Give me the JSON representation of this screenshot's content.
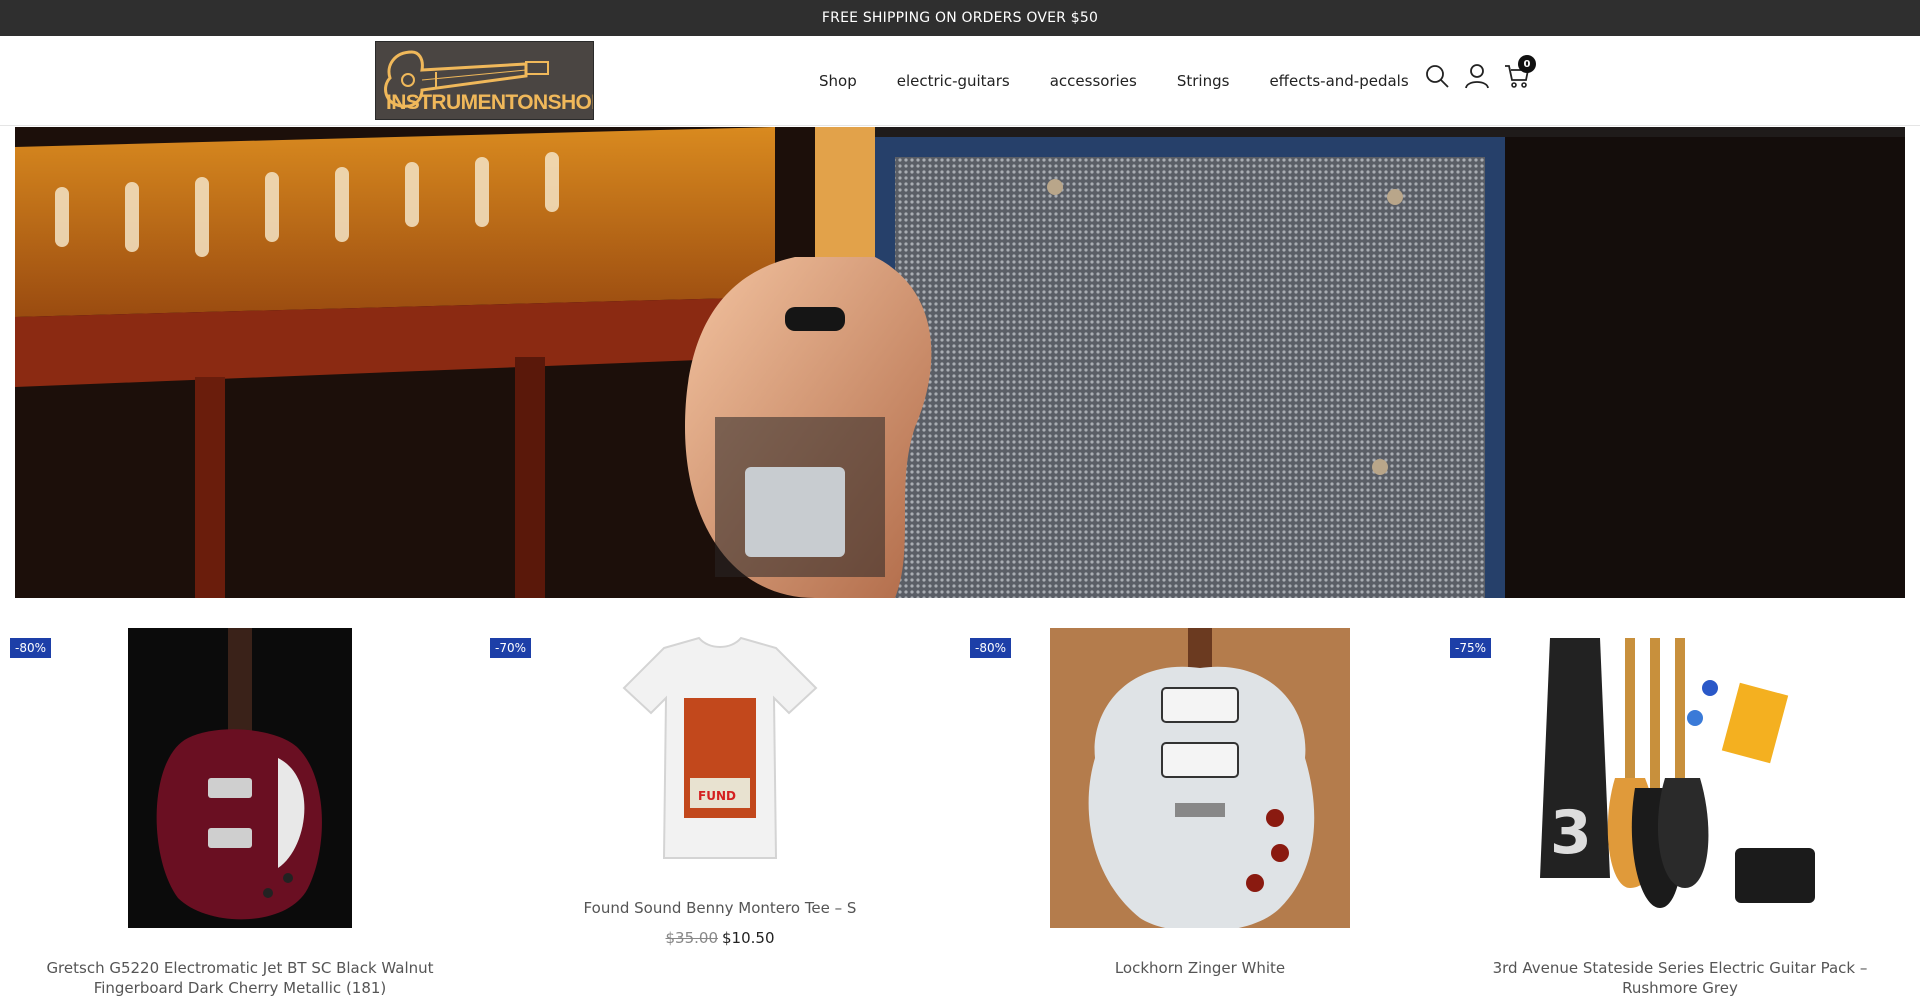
{
  "announcement": "FREE SHIPPING ON ORDERS OVER $50",
  "logo": {
    "text": "INSTRUMENTONSHOP"
  },
  "nav": [
    "Shop",
    "electric-guitars",
    "accessories",
    "Strings",
    "effects-and-pedals"
  ],
  "icons": {
    "search": "search-icon",
    "account": "user-icon",
    "cart": "cart-icon"
  },
  "cart": {
    "count": "0"
  },
  "colors": {
    "topbar": "#2f2f2f",
    "badge": "#1d3fa8",
    "logo_bg": "#4a4542",
    "logo_text": "#f0b85a"
  },
  "products": [
    {
      "discount": "-80%",
      "title": "Gretsch G5220 Electromatic Jet BT SC Black Walnut Fingerboard Dark Cherry Metallic (181)",
      "old_price": "",
      "price": ""
    },
    {
      "discount": "-70%",
      "title": "Found Sound Benny Montero Tee – S",
      "old_price": "$35.00",
      "price": "$10.50"
    },
    {
      "discount": "-80%",
      "title": "Lockhorn Zinger White",
      "old_price": "",
      "price": ""
    },
    {
      "discount": "-75%",
      "title": "3rd Avenue Stateside Series Electric Guitar Pack – Rushmore Grey",
      "old_price": "",
      "price": ""
    }
  ]
}
